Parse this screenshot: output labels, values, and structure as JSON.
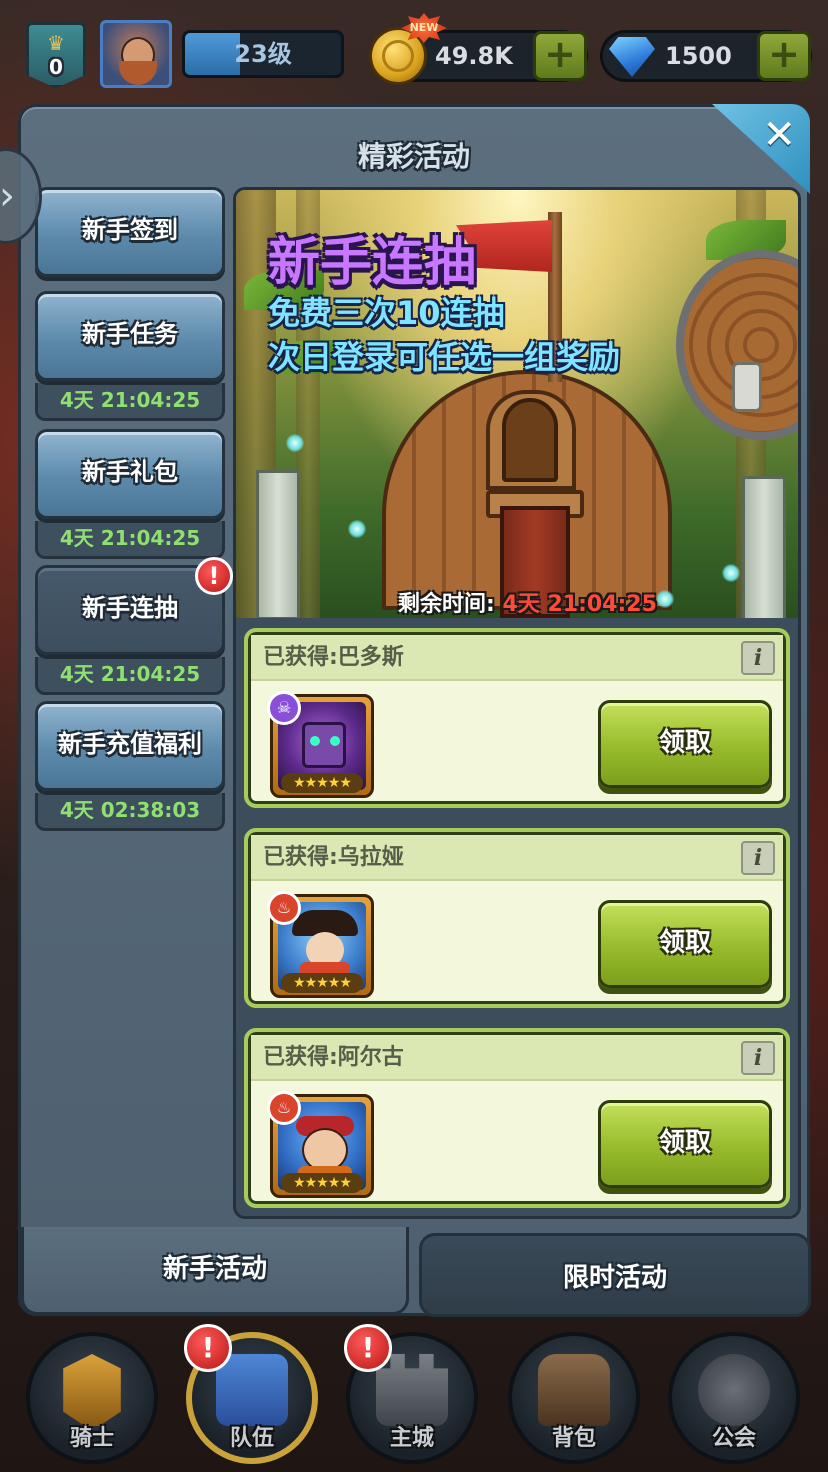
{
  "topbar": {
    "vip_level": "0",
    "player_level": "23级",
    "level_progress": 0.35,
    "new_badge": "NEW",
    "gold": "49.8K",
    "gems": "1500",
    "add_symbol": "+"
  },
  "panel": {
    "title": "精彩活动",
    "close_symbol": "✕",
    "expand_arrow": "›"
  },
  "sidebar": {
    "items": [
      {
        "label": "新手签到",
        "timer": "",
        "active": false,
        "alert": false
      },
      {
        "label": "新手任务",
        "timer": "4天 21:04:25",
        "active": false,
        "alert": false
      },
      {
        "label": "新手礼包",
        "timer": "4天 21:04:25",
        "active": false,
        "alert": false
      },
      {
        "label": "新手连抽",
        "timer": "4天 21:04:25",
        "active": true,
        "alert": true
      },
      {
        "label": "新手充值福利",
        "timer": "4天 02:38:03",
        "active": false,
        "alert": false
      }
    ],
    "alert_symbol": "!"
  },
  "banner": {
    "title": "新手连抽",
    "line1": "免费三次10连抽",
    "line2": "次日登录可任选一组奖励",
    "remaining_label": "剩余时间:",
    "remaining_value": "4天 21:04:25"
  },
  "rewards": [
    {
      "title": "已获得:巴多斯",
      "claim_label": "领取",
      "element_icon": "skull-icon",
      "element_color": "#8a4fd8",
      "stars": "★★★★★"
    },
    {
      "title": "已获得:乌拉娅",
      "claim_label": "领取",
      "element_icon": "fire-icon",
      "element_color": "#d8452a",
      "stars": "★★★★★"
    },
    {
      "title": "已获得:阿尔古",
      "claim_label": "领取",
      "element_icon": "fire-icon",
      "element_color": "#d8452a",
      "stars": "★★★★★"
    }
  ],
  "info_symbol": "i",
  "tabs": {
    "newbie": "新手活动",
    "limited": "限时活动"
  },
  "bottom_nav": [
    {
      "label": "骑士",
      "icon": "helmet-icon",
      "alert": false
    },
    {
      "label": "队伍",
      "icon": "team-shield-icon",
      "alert": true,
      "active": true
    },
    {
      "label": "主城",
      "icon": "castle-icon",
      "alert": true
    },
    {
      "label": "背包",
      "icon": "backpack-icon",
      "alert": false
    },
    {
      "label": "公会",
      "icon": "guild-emblem-icon",
      "alert": false
    }
  ]
}
